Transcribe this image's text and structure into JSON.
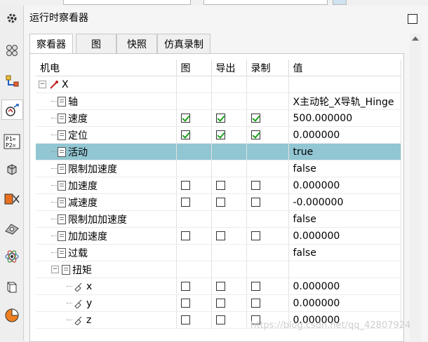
{
  "panel": {
    "title": "运行时察看器"
  },
  "tabs": [
    {
      "label": "察看器",
      "active": true
    },
    {
      "label": "图"
    },
    {
      "label": "快照"
    },
    {
      "label": "仿真录制"
    }
  ],
  "columns": [
    "机电",
    "图",
    "导出",
    "录制",
    "值"
  ],
  "rows": [
    {
      "name": "X",
      "level": 0,
      "value": "",
      "kind": "root"
    },
    {
      "name": "轴",
      "level": 1,
      "value": "X主动轮_X导轨_Hinge",
      "checks": null
    },
    {
      "name": "速度",
      "level": 1,
      "value": "500.000000",
      "checks": [
        true,
        true,
        true
      ]
    },
    {
      "name": "定位",
      "level": 1,
      "value": "0.000000",
      "checks": [
        true,
        true,
        true
      ]
    },
    {
      "name": "活动",
      "level": 1,
      "value": "true",
      "checks": null,
      "selected": true
    },
    {
      "name": "限制加速度",
      "level": 1,
      "value": "false",
      "checks": null
    },
    {
      "name": "加速度",
      "level": 1,
      "value": "0.000000",
      "checks": [
        false,
        false,
        false
      ]
    },
    {
      "name": "减速度",
      "level": 1,
      "value": "-0.000000",
      "checks": [
        false,
        false,
        false
      ]
    },
    {
      "name": "限制加加速度",
      "level": 1,
      "value": "false",
      "checks": null
    },
    {
      "name": "加加速度",
      "level": 1,
      "value": "0.000000",
      "checks": [
        false,
        false,
        false
      ]
    },
    {
      "name": "过载",
      "level": 1,
      "value": "false",
      "checks": null
    },
    {
      "name": "扭矩",
      "level": 1,
      "value": "",
      "checks": null,
      "expandable": true
    },
    {
      "name": "x",
      "level": 2,
      "value": "0.000000",
      "checks": [
        false,
        false,
        false
      ]
    },
    {
      "name": "y",
      "level": 2,
      "value": "0.000000",
      "checks": [
        false,
        false,
        false
      ]
    },
    {
      "name": "z",
      "level": 2,
      "value": "0.000000",
      "checks": [
        false,
        false,
        false
      ]
    }
  ],
  "watermark": "https://blog.csdn.net/qq_42807924",
  "sidebar_icons": [
    "gear-icon",
    "assembly-icon",
    "constraint-icon",
    "runtime-viewer-icon",
    "parameters-icon",
    "part-icon",
    "collision-icon",
    "sensor-icon",
    "physics-icon",
    "book-icon",
    "pie-chart-icon"
  ]
}
